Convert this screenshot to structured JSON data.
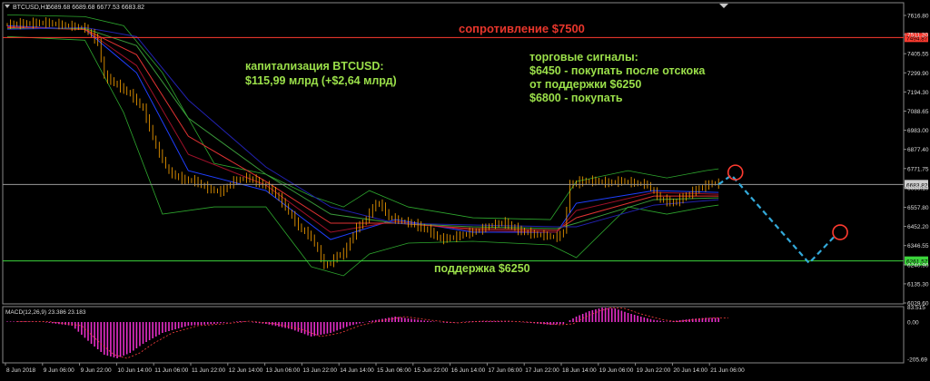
{
  "chart_data": {
    "type": "candlestick",
    "symbol_header": {
      "symbol": "BTCUSD,H1",
      "ohlc": "6689.68 6689.68 6677.53 6683.82"
    },
    "price_axis": {
      "ticks": [
        "7616.80",
        "7511.20",
        "7405.55",
        "7299.90",
        "7194.30",
        "7088.65",
        "6983.00",
        "6877.40",
        "6771.75",
        "6666.10",
        "6557.80",
        "6452.20",
        "6346.55",
        "6240.90",
        "6135.30",
        "6029.60"
      ],
      "ylim": [
        6029.6,
        7616.8
      ]
    },
    "price_labels": {
      "resistance": "7494.87",
      "current": "6683.82",
      "support": "6261.57"
    },
    "macd_panel": {
      "label": "MACD(12,26,9) 23.386 23.183",
      "ticks": [
        "83.515",
        "0.00",
        "-205.69"
      ]
    },
    "time_axis": [
      "8 Jun 2018",
      "9 Jun 06:00",
      "9 Jun 22:00",
      "10 Jun 14:00",
      "11 Jun 06:00",
      "11 Jun 22:00",
      "12 Jun 14:00",
      "13 Jun 06:00",
      "13 Jun 22:00",
      "14 Jun 14:00",
      "15 Jun 06:00",
      "15 Jun 22:00",
      "16 Jun 14:00",
      "17 Jun 06:00",
      "17 Jun 22:00",
      "18 Jun 14:00",
      "19 Jun 06:00",
      "19 Jun 22:00",
      "20 Jun 14:00",
      "21 Jun 06:00"
    ],
    "price_path": [
      [
        0,
        7565
      ],
      [
        3,
        7570
      ],
      [
        6,
        7575
      ],
      [
        9,
        7560
      ],
      [
        12,
        7545
      ],
      [
        14,
        7470
      ],
      [
        15,
        7280
      ],
      [
        17,
        7230
      ],
      [
        19,
        7180
      ],
      [
        21,
        7100
      ],
      [
        23,
        6890
      ],
      [
        25,
        6750
      ],
      [
        27,
        6710
      ],
      [
        29,
        6700
      ],
      [
        31,
        6660
      ],
      [
        33,
        6640
      ],
      [
        35,
        6700
      ],
      [
        37,
        6720
      ],
      [
        39,
        6690
      ],
      [
        41,
        6650
      ],
      [
        43,
        6560
      ],
      [
        45,
        6450
      ],
      [
        47,
        6390
      ],
      [
        48,
        6320
      ],
      [
        49,
        6235
      ],
      [
        50,
        6250
      ],
      [
        51,
        6290
      ],
      [
        52,
        6300
      ],
      [
        53,
        6370
      ],
      [
        54,
        6440
      ],
      [
        55,
        6470
      ],
      [
        56,
        6520
      ],
      [
        57,
        6580
      ],
      [
        58,
        6560
      ],
      [
        59,
        6500
      ],
      [
        61,
        6480
      ],
      [
        63,
        6460
      ],
      [
        65,
        6430
      ],
      [
        67,
        6380
      ],
      [
        69,
        6390
      ],
      [
        71,
        6410
      ],
      [
        73,
        6430
      ],
      [
        75,
        6460
      ],
      [
        77,
        6470
      ],
      [
        79,
        6430
      ],
      [
        81,
        6410
      ],
      [
        83,
        6400
      ],
      [
        85,
        6390
      ],
      [
        86,
        6420
      ],
      [
        87,
        6680
      ],
      [
        89,
        6700
      ],
      [
        91,
        6700
      ],
      [
        93,
        6690
      ],
      [
        95,
        6700
      ],
      [
        97,
        6690
      ],
      [
        99,
        6680
      ],
      [
        101,
        6600
      ],
      [
        103,
        6580
      ],
      [
        105,
        6620
      ],
      [
        107,
        6660
      ],
      [
        109,
        6690
      ],
      [
        110,
        6684
      ]
    ],
    "series": [
      {
        "name": "",
        "values": [
          [
            0,
            7560
          ],
          [
            12,
            7540
          ],
          [
            20,
            7300
          ],
          [
            28,
            6760
          ],
          [
            40,
            6650
          ],
          [
            50,
            6380
          ],
          [
            60,
            6490
          ],
          [
            72,
            6420
          ],
          [
            85,
            6420
          ],
          [
            88,
            6580
          ],
          [
            100,
            6650
          ],
          [
            110,
            6640
          ]
        ]
      },
      {
        "name": "",
        "values": [
          [
            0,
            7555
          ],
          [
            12,
            7540
          ],
          [
            20,
            7340
          ],
          [
            28,
            6850
          ],
          [
            40,
            6680
          ],
          [
            50,
            6420
          ],
          [
            60,
            6480
          ],
          [
            72,
            6430
          ],
          [
            85,
            6420
          ],
          [
            88,
            6540
          ],
          [
            100,
            6640
          ],
          [
            110,
            6630
          ]
        ]
      },
      {
        "name": "",
        "values": [
          [
            0,
            7550
          ],
          [
            12,
            7540
          ],
          [
            20,
            7400
          ],
          [
            28,
            6950
          ],
          [
            40,
            6700
          ],
          [
            50,
            6470
          ],
          [
            60,
            6470
          ],
          [
            72,
            6440
          ],
          [
            85,
            6430
          ],
          [
            88,
            6500
          ],
          [
            100,
            6620
          ],
          [
            110,
            6620
          ]
        ]
      },
      {
        "name": "",
        "values": [
          [
            0,
            7545
          ],
          [
            12,
            7545
          ],
          [
            20,
            7450
          ],
          [
            28,
            7050
          ],
          [
            40,
            6740
          ],
          [
            50,
            6520
          ],
          [
            60,
            6470
          ],
          [
            72,
            6450
          ],
          [
            85,
            6440
          ],
          [
            88,
            6470
          ],
          [
            100,
            6600
          ],
          [
            110,
            6610
          ]
        ]
      },
      {
        "name": "",
        "values": [
          [
            0,
            7540
          ],
          [
            12,
            7550
          ],
          [
            20,
            7500
          ],
          [
            28,
            7150
          ],
          [
            40,
            6780
          ],
          [
            50,
            6560
          ],
          [
            60,
            6470
          ],
          [
            72,
            6460
          ],
          [
            85,
            6450
          ],
          [
            88,
            6450
          ],
          [
            100,
            6570
          ],
          [
            110,
            6600
          ]
        ]
      }
    ],
    "bollinger": {
      "upper": [
        [
          0,
          7620
        ],
        [
          12,
          7610
        ],
        [
          18,
          7560
        ],
        [
          24,
          7300
        ],
        [
          32,
          6800
        ],
        [
          40,
          6740
        ],
        [
          47,
          6620
        ],
        [
          52,
          6560
        ],
        [
          56,
          6650
        ],
        [
          62,
          6560
        ],
        [
          72,
          6500
        ],
        [
          84,
          6490
        ],
        [
          88,
          6700
        ],
        [
          96,
          6760
        ],
        [
          102,
          6720
        ],
        [
          108,
          6760
        ],
        [
          110,
          6770
        ]
      ],
      "lower": [
        [
          0,
          7500
        ],
        [
          12,
          7480
        ],
        [
          18,
          7080
        ],
        [
          24,
          6520
        ],
        [
          32,
          6560
        ],
        [
          40,
          6560
        ],
        [
          47,
          6230
        ],
        [
          52,
          6180
        ],
        [
          56,
          6300
        ],
        [
          62,
          6360
        ],
        [
          72,
          6370
        ],
        [
          84,
          6350
        ],
        [
          88,
          6280
        ],
        [
          96,
          6560
        ],
        [
          102,
          6520
        ],
        [
          108,
          6560
        ],
        [
          110,
          6570
        ]
      ]
    },
    "macd_values": [
      [
        0,
        3
      ],
      [
        5,
        2
      ],
      [
        10,
        -20
      ],
      [
        13,
        -120
      ],
      [
        15,
        -180
      ],
      [
        17,
        -200
      ],
      [
        19,
        -170
      ],
      [
        21,
        -120
      ],
      [
        24,
        -60
      ],
      [
        28,
        -20
      ],
      [
        32,
        -10
      ],
      [
        36,
        5
      ],
      [
        40,
        -10
      ],
      [
        44,
        -40
      ],
      [
        47,
        -80
      ],
      [
        50,
        -60
      ],
      [
        53,
        -20
      ],
      [
        56,
        5
      ],
      [
        60,
        30
      ],
      [
        64,
        10
      ],
      [
        68,
        -5
      ],
      [
        72,
        5
      ],
      [
        76,
        5
      ],
      [
        80,
        -2
      ],
      [
        84,
        -15
      ],
      [
        86,
        -10
      ],
      [
        88,
        30
      ],
      [
        90,
        60
      ],
      [
        92,
        80
      ],
      [
        94,
        75
      ],
      [
        96,
        50
      ],
      [
        98,
        30
      ],
      [
        100,
        12
      ],
      [
        102,
        2
      ],
      [
        104,
        10
      ],
      [
        106,
        18
      ],
      [
        108,
        23
      ],
      [
        110,
        23
      ]
    ],
    "forecast_path": [
      [
        110,
        6684
      ],
      [
        112,
        6735
      ],
      [
        124,
        6250
      ],
      [
        128,
        6400
      ]
    ]
  },
  "annotations": {
    "resistance_text": "сопротивление $7500",
    "cap_line1": "капитализация BTCUSD:",
    "cap_line2": "$115,99 млрд (+$2,64 млрд)",
    "signals_line1": "торговые сигналы:",
    "signals_line2": "$6450 - покупать после отскока",
    "signals_line3": "от поддержки $6250",
    "signals_line4": "$6800 - покупать",
    "support_text": "поддержка $6250"
  },
  "colors": {
    "bg": "#000000",
    "candle": "#ffa500",
    "resistance": "#ff3b30",
    "support": "#3cd43c",
    "text_green": "#9be04a",
    "text_red": "#e8362c",
    "macd": "#e62ec8",
    "forecast": "#33a9d9",
    "bollinger": "#2ea82e",
    "ma": [
      "#1f3fff",
      "#a0112a",
      "#e03232",
      "#3a9a3a",
      "#2222b0"
    ]
  }
}
